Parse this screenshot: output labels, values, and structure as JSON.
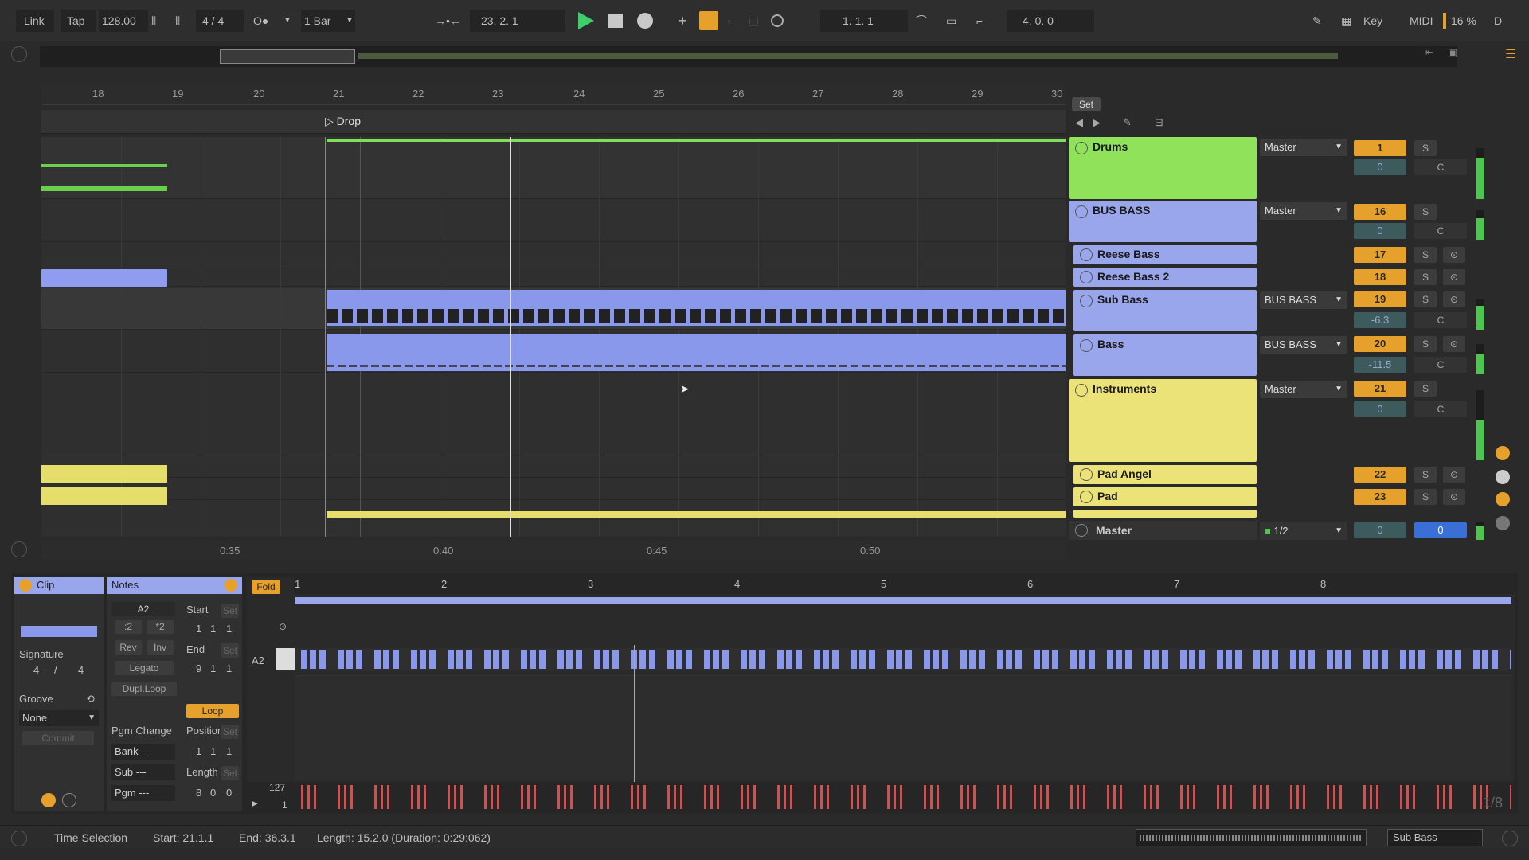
{
  "transport": {
    "link": "Link",
    "tap": "Tap",
    "tempo": "128.00",
    "signature": "4 / 4",
    "quantize": "1 Bar",
    "position": "23.  2.  1",
    "loop_start": "1.  1.  1",
    "loop_length": "4.  0.  0",
    "key_label": "Key",
    "midi_label": "MIDI",
    "cpu": "16 %",
    "cpu_extra": "D"
  },
  "ruler": {
    "bars": [
      "18",
      "19",
      "20",
      "21",
      "22",
      "23",
      "24",
      "25",
      "26",
      "27",
      "28",
      "29",
      "30"
    ],
    "set_label": "Set",
    "locator": "Drop"
  },
  "time_ruler": {
    "labels": [
      "0:35",
      "0:40",
      "0:45",
      "0:50"
    ]
  },
  "tracks": [
    {
      "name": "Drums",
      "output": "Master",
      "number": "1",
      "volume": "0",
      "pan": "C",
      "color": "#93e25a",
      "solo": "S"
    },
    {
      "name": "BUS BASS",
      "output": "Master",
      "number": "16",
      "volume": "0",
      "pan": "C",
      "color": "#9aa6ec",
      "solo": "S"
    },
    {
      "name": "Reese Bass",
      "number": "17",
      "color": "#9aa6ec",
      "solo": "S"
    },
    {
      "name": "Reese Bass 2",
      "number": "18",
      "color": "#9aa6ec",
      "solo": "S"
    },
    {
      "name": "Sub Bass",
      "output": "BUS BASS",
      "number": "19",
      "volume": "-6.3",
      "pan": "C",
      "color": "#9aa6ec",
      "solo": "S"
    },
    {
      "name": "Bass",
      "output": "BUS BASS",
      "number": "20",
      "volume": "-11.5",
      "pan": "C",
      "color": "#9aa6ec",
      "solo": "S"
    },
    {
      "name": "Instruments",
      "output": "Master",
      "number": "21",
      "volume": "0",
      "pan": "C",
      "color": "#ece378",
      "solo": "S"
    },
    {
      "name": "Pad Angel",
      "number": "22",
      "color": "#ece378",
      "solo": "S"
    },
    {
      "name": "Pad",
      "number": "23",
      "color": "#ece378",
      "solo": "S"
    }
  ],
  "master": {
    "name": "Master",
    "output": "1/2",
    "volume": "0",
    "volume2": "0"
  },
  "clip": {
    "tab_clip": "Clip",
    "tab_notes": "Notes",
    "signature_label": "Signature",
    "sig_num": "4",
    "sig_den": "4",
    "groove_label": "Groove",
    "groove_value": "None",
    "commit": "Commit",
    "note": "A2",
    "div2": ":2",
    "mul2": "*2",
    "rev": "Rev",
    "inv": "Inv",
    "legato": "Legato",
    "dupl": "Dupl.Loop",
    "start_label": "Start",
    "start_val": [
      "1",
      "1",
      "1"
    ],
    "end_label": "End",
    "end_val": [
      "9",
      "1",
      "1"
    ],
    "loop": "Loop",
    "position_label": "Position",
    "position_val": [
      "1",
      "1",
      "1"
    ],
    "length_label": "Length",
    "length_val": [
      "8",
      "0",
      "0"
    ],
    "set_btn": "Set",
    "pgm_change": "Pgm Change",
    "bank": "Bank ---",
    "sub": "Sub ---",
    "pgm": "Pgm ---",
    "fold": "Fold",
    "bars": [
      "1",
      "2",
      "3",
      "4",
      "5",
      "6",
      "7",
      "8"
    ],
    "key_label": "A2",
    "vel_max": "127",
    "vel_min": "1",
    "grid_label": "1/8"
  },
  "status": {
    "mode": "Time Selection",
    "start": "Start: 21.1.1",
    "end": "End: 36.3.1",
    "length": "Length: 15.2.0 (Duration: 0:29:062)",
    "track": "Sub Bass"
  }
}
